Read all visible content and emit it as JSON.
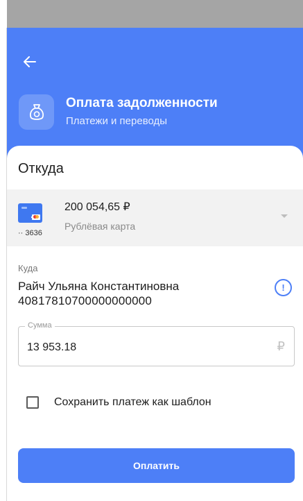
{
  "header": {
    "title": "Оплата задолженности",
    "subtitle": "Платежи и переводы",
    "icon": "money-bag-icon",
    "color": "#4d7ff7"
  },
  "source": {
    "section_title": "Откуда",
    "amount": "200 054,65 ₽",
    "card_type": "Рублёвая карта",
    "card_number": "·· 3636"
  },
  "destination": {
    "label": "Куда",
    "name": "Райч Ульяна Константиновна",
    "account": "40817810700000000000"
  },
  "sum": {
    "label": "Сумма",
    "value": "13 953.18",
    "currency": "₽"
  },
  "save_template": {
    "label": "Сохранить платеж как шаблон",
    "checked": false
  },
  "pay_button": {
    "label": "Оплатить"
  }
}
